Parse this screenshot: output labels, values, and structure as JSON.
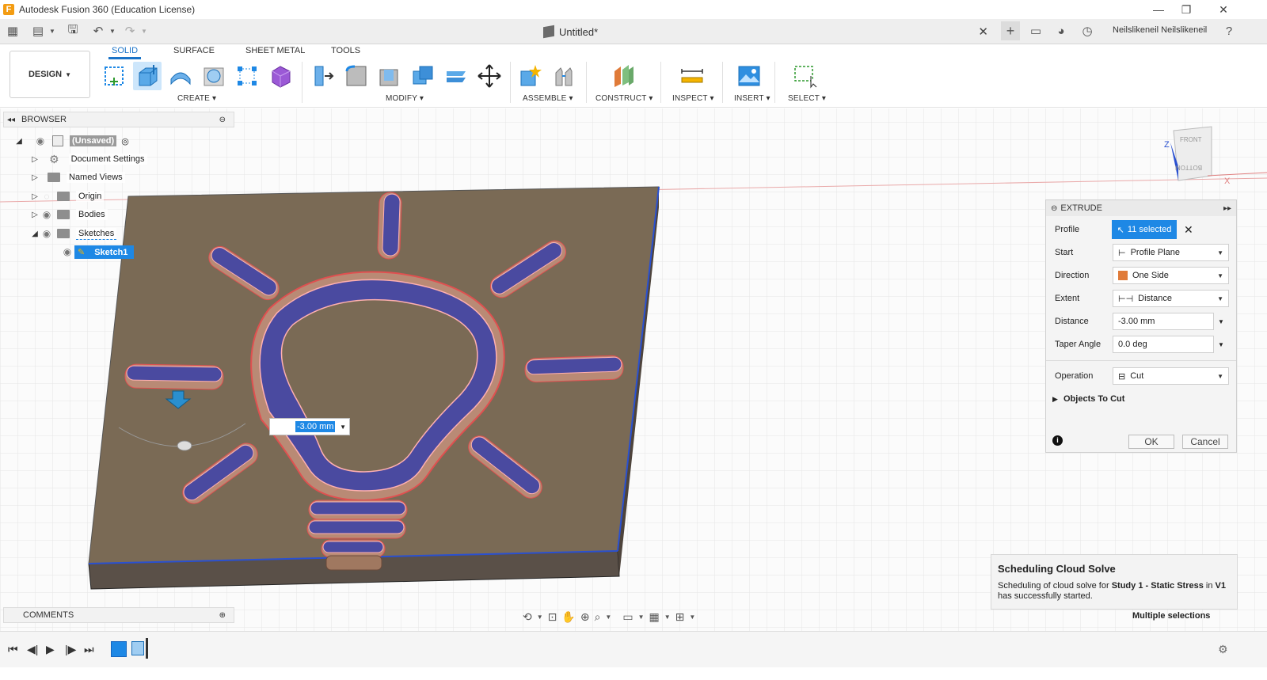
{
  "app": {
    "window_title": "Autodesk Fusion 360 (Education License)",
    "logo_letter": "F",
    "doc_name": "Untitled*",
    "user_name": "Neilslikeneil Neilslikeneil"
  },
  "ribbon": {
    "workspace": "DESIGN",
    "tabs": [
      "SOLID",
      "SURFACE",
      "SHEET METAL",
      "TOOLS"
    ],
    "groups": [
      "CREATE",
      "MODIFY",
      "ASSEMBLE",
      "CONSTRUCT",
      "INSPECT",
      "INSERT",
      "SELECT"
    ]
  },
  "browser": {
    "title": "BROWSER",
    "items": [
      {
        "label": "(Unsaved)"
      },
      {
        "label": "Document Settings"
      },
      {
        "label": "Named Views"
      },
      {
        "label": "Origin"
      },
      {
        "label": "Bodies"
      },
      {
        "label": "Sketches"
      },
      {
        "label": "Sketch1"
      }
    ]
  },
  "extrude": {
    "title": "EXTRUDE",
    "rows": {
      "profile": {
        "label": "Profile",
        "value": "11 selected"
      },
      "start": {
        "label": "Start",
        "value": "Profile Plane"
      },
      "direction": {
        "label": "Direction",
        "value": "One Side"
      },
      "extent": {
        "label": "Extent",
        "value": "Distance"
      },
      "distance": {
        "label": "Distance",
        "value": "-3.00 mm"
      },
      "taper": {
        "label": "Taper Angle",
        "value": "0.0 deg"
      },
      "operation": {
        "label": "Operation",
        "value": "Cut"
      }
    },
    "objects_to_cut": "Objects To Cut",
    "ok": "OK",
    "cancel": "Cancel"
  },
  "viewport": {
    "dimension_value": "-3.00 mm",
    "viewcube": {
      "front": "FRONT",
      "bottom": "BOTTOM"
    }
  },
  "notification": {
    "title": "Scheduling Cloud Solve",
    "body_prefix": "Scheduling of cloud solve for ",
    "body_bold": "Study 1 - Static Stress",
    "body_mid": " in ",
    "body_version": "V1",
    "body_suffix": "has successfully started."
  },
  "status": {
    "multiple_selections": "Multiple selections"
  },
  "comments": {
    "title": "COMMENTS"
  },
  "colors": {
    "accent": "#1e88e5",
    "plate": "#7a6a55",
    "cut": "#4a4aa0",
    "wall": "#b98a75"
  }
}
